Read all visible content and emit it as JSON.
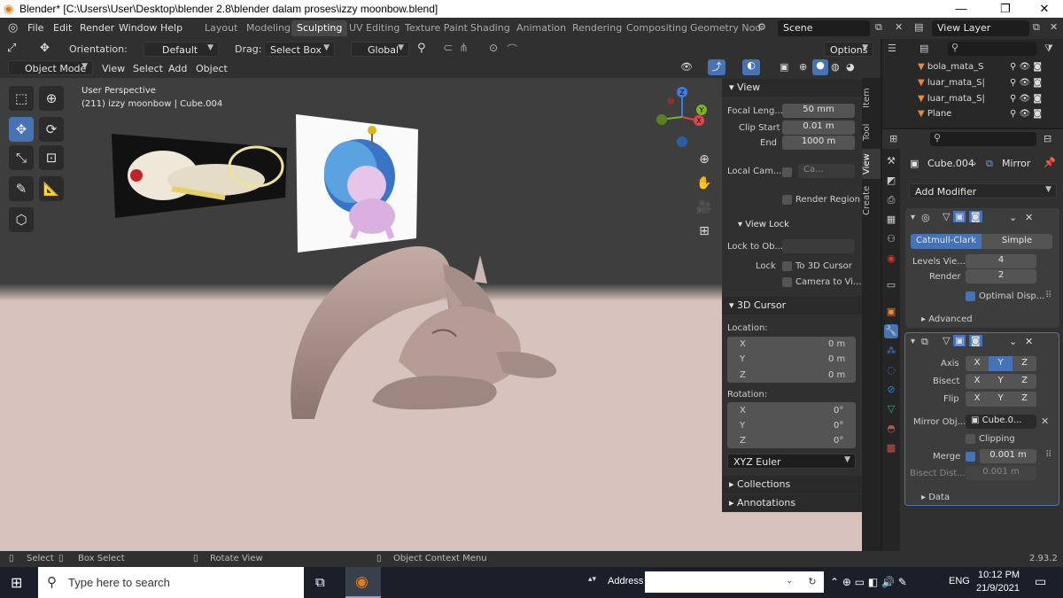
{
  "window": {
    "title": "Blender* [C:\\Users\\User\\Desktop\\blender 2.8\\blender dalam proses\\izzy moonbow.blend]",
    "min": "—",
    "max": "❐",
    "close": "✕"
  },
  "menus": [
    "File",
    "Edit",
    "Render",
    "Window",
    "Help"
  ],
  "workspaces": [
    "Layout",
    "Modeling",
    "Sculpting",
    "UV Editing",
    "Texture Paint",
    "Shading",
    "Animation",
    "Rendering",
    "Compositing",
    "Geometry Nod"
  ],
  "scene": "Scene",
  "view_layer": "View Layer",
  "header": {
    "orientation_label": "Orientation:",
    "orientation": "Default",
    "drag_label": "Drag:",
    "drag": "Select Box",
    "transform": "Global",
    "options": "Options"
  },
  "header2": {
    "mode": "Object Mode",
    "view": "View",
    "select": "Select",
    "add": "Add",
    "object": "Object"
  },
  "viewport": {
    "perspective": "User Perspective",
    "info": "(211) izzy moonbow | Cube.004",
    "gizmo": {
      "x": "X",
      "y": "Y",
      "z": "Z"
    }
  },
  "npanel": {
    "view": "View",
    "focal_label": "Focal Leng...",
    "focal": "50 mm",
    "clip_label": "Clip Start",
    "clip_start": "0.01 m",
    "end_label": "End",
    "clip_end": "1000 m",
    "local_cam_label": "Local Cam...",
    "local_cam": "Ca...",
    "render_region": "Render Region",
    "view_lock": "View Lock",
    "lock_to_label": "Lock to Ob...",
    "lock_label": "Lock",
    "to_3d_cursor": "To 3D Cursor",
    "camera_to_view": "Camera to Vi...",
    "cursor": "3D Cursor",
    "location": "Location:",
    "rotation": "Rotation:",
    "loc": [
      {
        "a": "X",
        "v": "0 m"
      },
      {
        "a": "Y",
        "v": "0 m"
      },
      {
        "a": "Z",
        "v": "0 m"
      }
    ],
    "rot": [
      {
        "a": "X",
        "v": "0°"
      },
      {
        "a": "Y",
        "v": "0°"
      },
      {
        "a": "Z",
        "v": "0°"
      }
    ],
    "rot_mode": "XYZ Euler",
    "collections": "Collections",
    "annotations": "Annotations"
  },
  "vtabs": [
    "Item",
    "Tool",
    "View",
    "Create"
  ],
  "outliner": [
    {
      "name": "bola_mata_S"
    },
    {
      "name": "luar_mata_S|"
    },
    {
      "name": "luar_mata_S|"
    },
    {
      "name": "Plane"
    }
  ],
  "props": {
    "object": "Cube.004",
    "modifier": "Mirror",
    "add_modifier": "Add Modifier",
    "catmull": "Catmull-Clark",
    "simple": "Simple",
    "levels_label": "Levels Vie...",
    "levels": "4",
    "render_label": "Render",
    "render": "2",
    "optimal": "Optimal Disp...",
    "advanced": "Advanced",
    "axis_label": "Axis",
    "bisect_label": "Bisect",
    "flip_label": "Flip",
    "x": "X",
    "y": "Y",
    "z": "Z",
    "mirror_obj_label": "Mirror Obj...",
    "mirror_obj": "Cube.0...",
    "clipping": "Clipping",
    "merge_label": "Merge",
    "merge": "0.001 m",
    "bisect_dist_label": "Bisect Dist...",
    "bisect_dist": "0.001 m",
    "data": "Data"
  },
  "status": {
    "select": "Select",
    "box_select": "Box Select",
    "rotate_view": "Rotate View",
    "context_menu": "Object Context Menu",
    "version": "2.93.2"
  },
  "taskbar": {
    "search_placeholder": "Type here to search",
    "address": "Address",
    "lang": "ENG",
    "time": "10:12 PM",
    "date": "21/9/2021"
  }
}
